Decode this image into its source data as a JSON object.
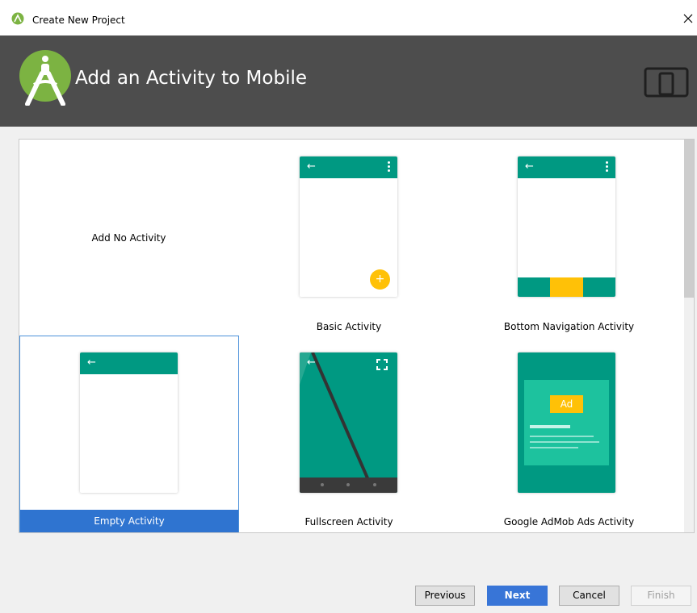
{
  "window": {
    "title": "Create New Project",
    "close_glyph": "✕"
  },
  "banner": {
    "heading": "Add an Activity to Mobile",
    "logo_icon": "android-studio-logo-icon",
    "form_factor_icon": "mobile-tablet-icon"
  },
  "gallery": {
    "items": [
      {
        "label": "Add No Activity",
        "selected": false
      },
      {
        "label": "Basic Activity",
        "selected": false
      },
      {
        "label": "Bottom Navigation Activity",
        "selected": false
      },
      {
        "label": "Empty Activity",
        "selected": true
      },
      {
        "label": "Fullscreen Activity",
        "selected": false
      },
      {
        "label": "Google AdMob Ads Activity",
        "selected": false
      }
    ],
    "ad_badge": "Ad",
    "back_arrow": "←",
    "fab_glyph": "+"
  },
  "buttons": {
    "previous": "Previous",
    "next": "Next",
    "cancel": "Cancel",
    "finish": "Finish"
  },
  "colors": {
    "teal": "#009982",
    "accent_yellow": "#ffc107",
    "selection_blue": "#2f74d0",
    "banner_gray": "#4d4d4d"
  }
}
